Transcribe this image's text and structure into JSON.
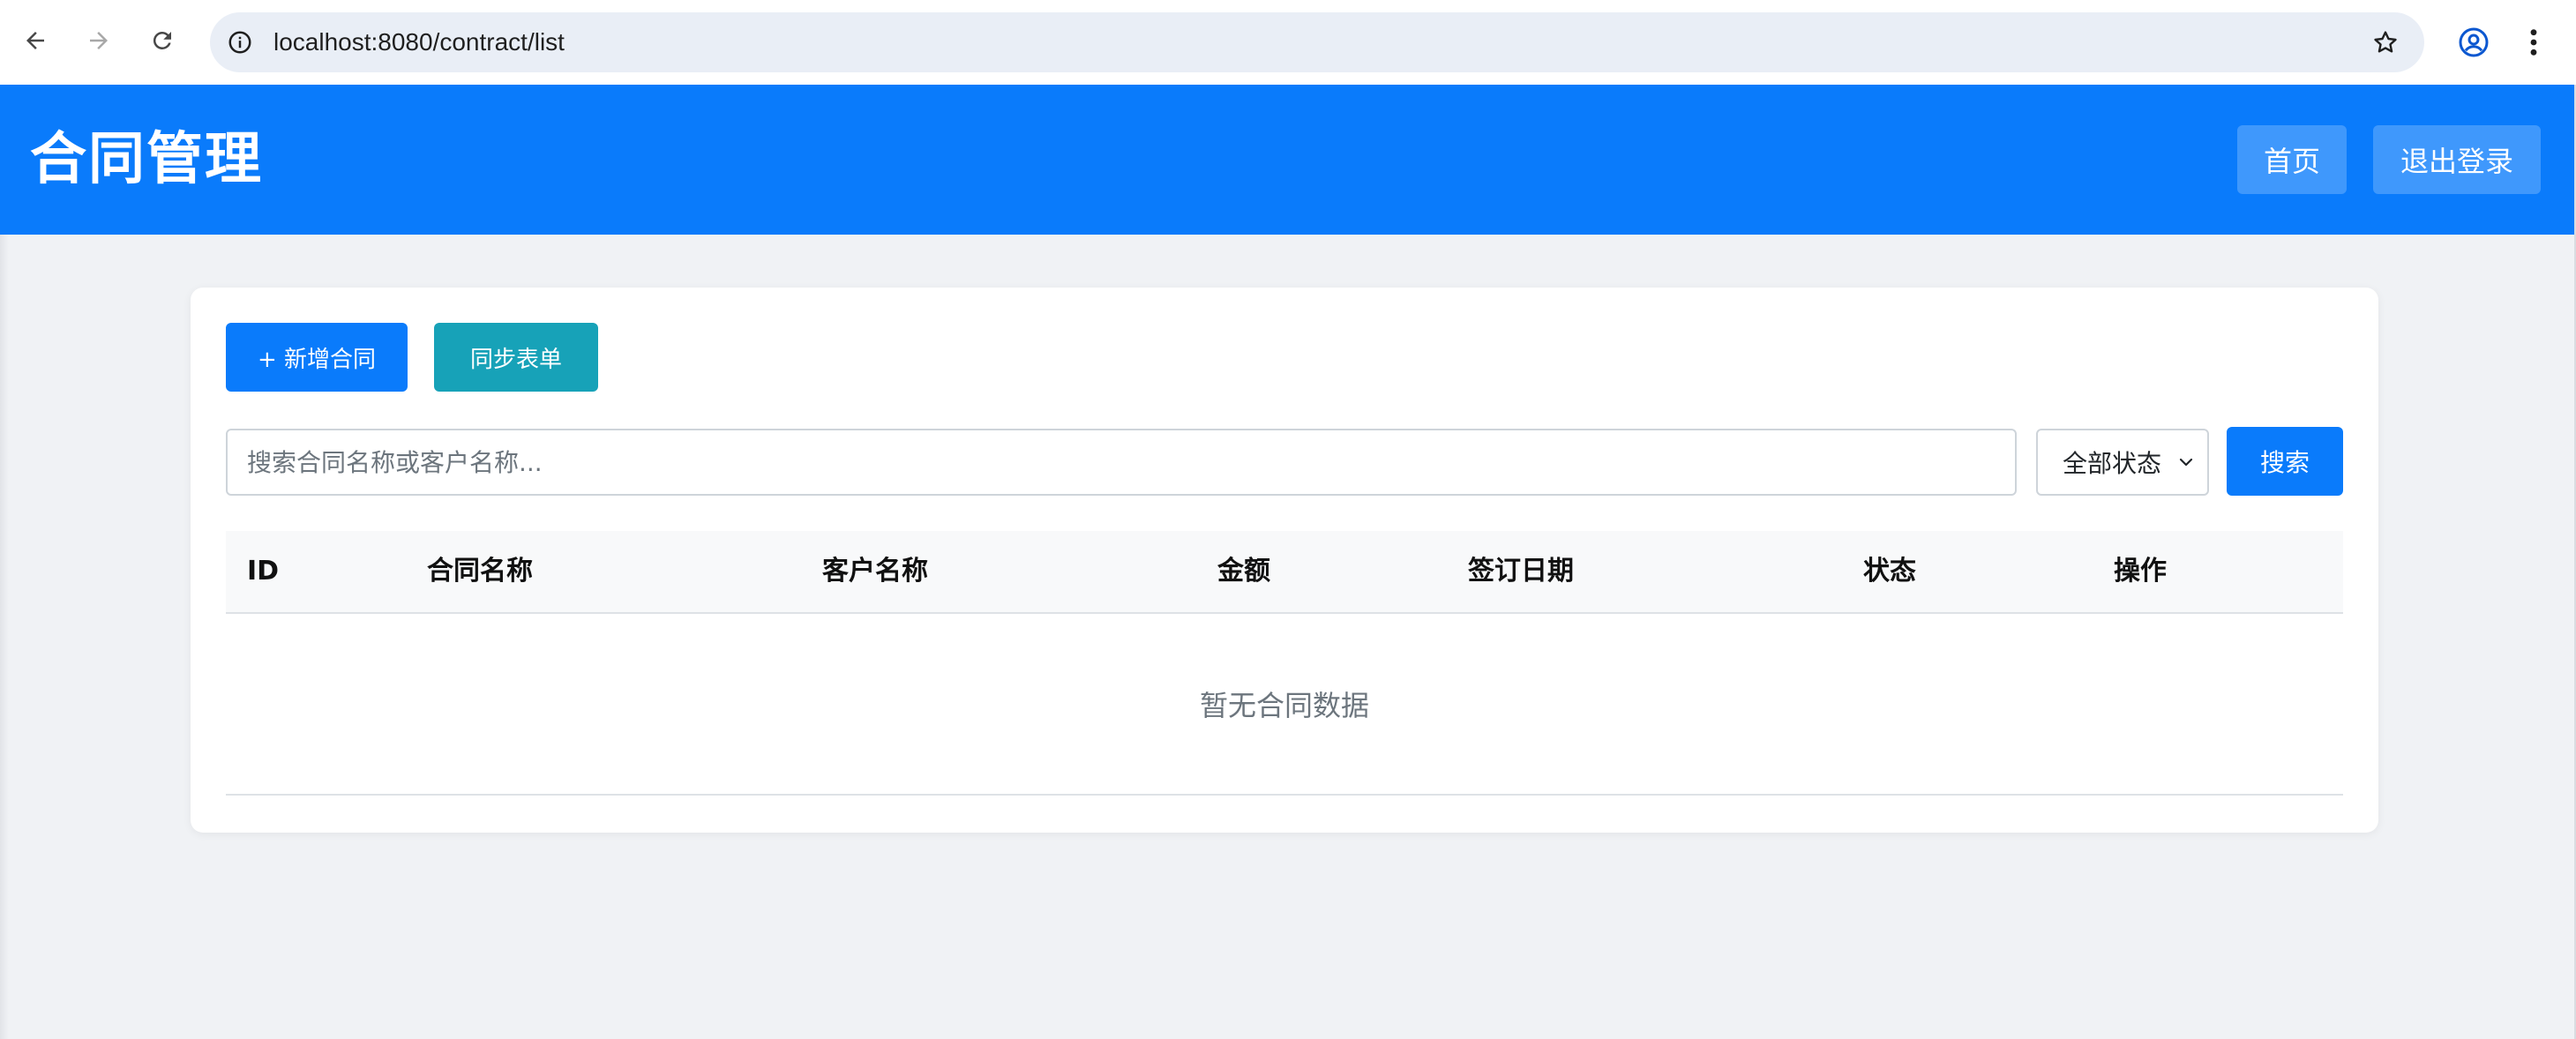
{
  "browser": {
    "url": "localhost:8080/contract/list"
  },
  "header": {
    "title": "合同管理",
    "home_label": "首页",
    "logout_label": "退出登录"
  },
  "toolbar": {
    "add_label": "+ 新增合同",
    "sync_label": "同步表单"
  },
  "search": {
    "value": "",
    "placeholder": "搜索合同名称或客户名称...",
    "status_selected": "全部状态",
    "button_label": "搜索"
  },
  "table": {
    "columns": [
      "ID",
      "合同名称",
      "客户名称",
      "金额",
      "签订日期",
      "状态",
      "操作"
    ],
    "rows": [],
    "empty_text": "暂无合同数据"
  },
  "colors": {
    "primary": "#0a7bfb",
    "info": "#17a2b8",
    "page_background": "#f0f2f5"
  },
  "icons": [
    "back-arrow-icon",
    "forward-arrow-icon",
    "reload-icon",
    "site-info-icon",
    "bookmark-star-icon",
    "profile-icon",
    "more-vert-icon",
    "chevron-down-icon"
  ]
}
